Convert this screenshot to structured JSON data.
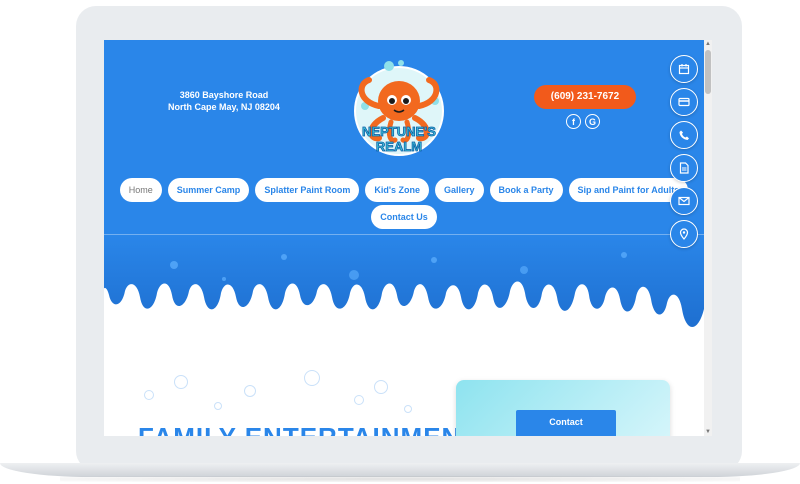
{
  "header": {
    "address_line1": "3860 Bayshore Road",
    "address_line2": "North Cape May, NJ 08204",
    "phone": "(609) 231-7672",
    "logo_line1": "NEPTUNE'S",
    "logo_line2": "REALM"
  },
  "social": {
    "facebook": "f",
    "google": "G"
  },
  "nav": {
    "row1": [
      "Home",
      "Summer Camp",
      "Splatter Paint Room",
      "Kid's Zone",
      "Gallery",
      "Book a Party",
      "Sip and Paint for Adults"
    ],
    "row2": [
      "Contact Us"
    ],
    "active": "Home"
  },
  "main": {
    "headline": "FAMILY ENTERTAINMENT",
    "contact_button": "Contact"
  },
  "side_icons": [
    "calendar-icon",
    "credit-card-icon",
    "phone-icon",
    "document-icon",
    "mail-icon",
    "location-pin-icon"
  ],
  "colors": {
    "brand_blue": "#2a86e9",
    "phone_orange": "#f25a1b",
    "laptop_frame": "#e9ecef"
  }
}
